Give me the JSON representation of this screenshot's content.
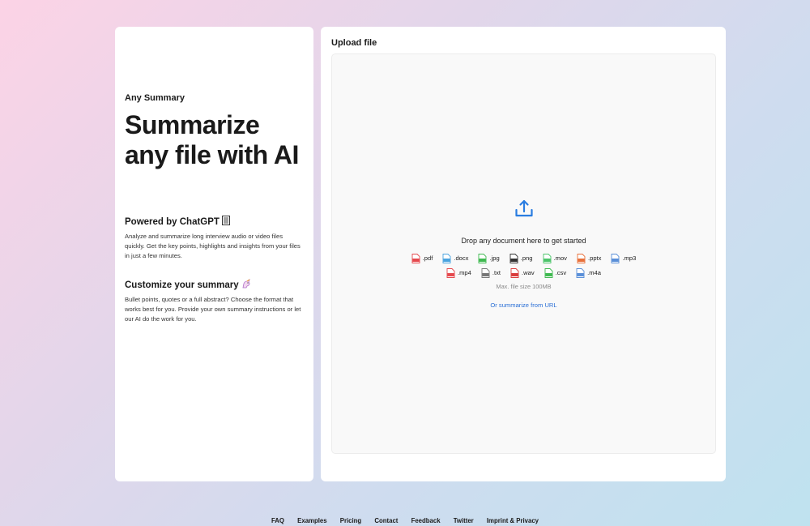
{
  "left": {
    "brand": "Any Summary",
    "headline": "Summarize any file with AI",
    "features": [
      {
        "title": "Powered by ChatGPT",
        "icon": "page-icon",
        "description": "Analyze and summarize long interview audio or video files quickly. Get the key points, highlights and insights from your files in just a few minutes."
      },
      {
        "title": "Customize your summary",
        "icon": "unicorn-icon",
        "description": "Bullet points, quotes or a full abstract? Choose the format that works best for you. Provide your own summary instructions or let our AI do the work for you."
      }
    ]
  },
  "upload": {
    "title": "Upload file",
    "drop_text": "Drop any document here to get started",
    "file_types_row1": [
      {
        "ext": ".pdf",
        "color": "#e5484d"
      },
      {
        "ext": ".docx",
        "color": "#4aa3df"
      },
      {
        "ext": ".jpg",
        "color": "#3fb950"
      },
      {
        "ext": ".png",
        "color": "#333333"
      },
      {
        "ext": ".mov",
        "color": "#4cc46a"
      },
      {
        "ext": ".pptx",
        "color": "#e8703a"
      },
      {
        "ext": ".mp3",
        "color": "#5a8fd8"
      }
    ],
    "file_types_row2": [
      {
        "ext": ".mp4",
        "color": "#e5484d"
      },
      {
        "ext": ".txt",
        "color": "#777777"
      },
      {
        "ext": ".wav",
        "color": "#d93b3b"
      },
      {
        "ext": ".csv",
        "color": "#3fb950"
      },
      {
        "ext": ".m4a",
        "color": "#5a8fd8"
      }
    ],
    "max_size": "Max. file size 100MB",
    "url_link": "Or summarize from URL",
    "accent": "#2a7de1"
  },
  "footer": {
    "links": [
      "FAQ",
      "Examples",
      "Pricing",
      "Contact",
      "Feedback",
      "Twitter",
      "Imprint & Privacy"
    ]
  }
}
